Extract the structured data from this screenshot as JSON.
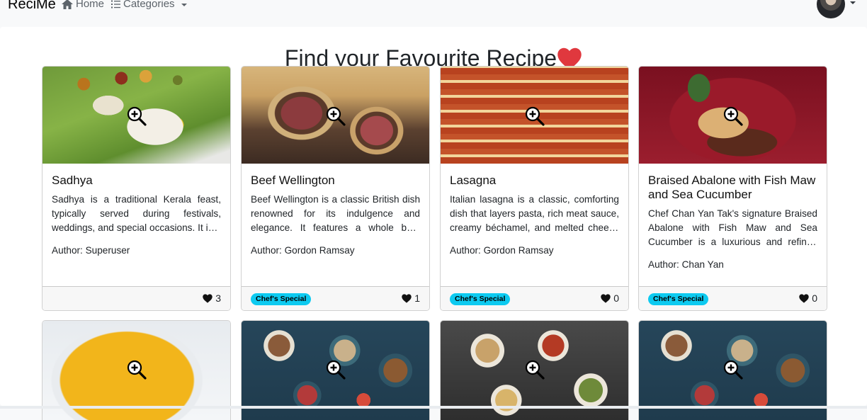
{
  "navbar": {
    "brand": "ReciMe",
    "home_label": "Home",
    "categories_label": "Categories"
  },
  "page": {
    "title": "Find your Favourite Recipe"
  },
  "recipes": [
    {
      "title": "Sadhya",
      "description": "Sadhya is a traditional Kerala feast, typically served during festivals, weddings, and special occasions. It is a vegetarian meal served on a banana leaf.",
      "author": "Author: Superuser",
      "badge": "",
      "likes": "3",
      "image": "sadhya-photo"
    },
    {
      "title": "Beef Wellington",
      "description": "Beef Wellington is a classic British dish renowned for its indulgence and elegance. It features a whole beef tenderloin wrapped in puff pastry.",
      "author": "Author: Gordon Ramsay",
      "badge": "Chef's Special",
      "likes": "1",
      "image": "beef-wellington-photo"
    },
    {
      "title": "Lasagna",
      "description": "Italian lasagna is a classic, comforting dish that layers pasta, rich meat sauce, creamy béchamel, and melted cheese baked to perfection.",
      "author": "Author: Gordon Ramsay",
      "badge": "Chef's Special",
      "likes": "0",
      "image": "lasagna-photo"
    },
    {
      "title": "Braised Abalone with Fish Maw and Sea Cucumber",
      "description": "Chef Chan Yan Tak's signature Braised Abalone with Fish Maw and Sea Cucumber is a luxurious and refined dish of Cantonese cuisine.",
      "author": "Author: Chan Yan",
      "badge": "Chef's Special",
      "likes": "0",
      "image": "braised-abalone-photo"
    }
  ],
  "recipes_row2": [
    {
      "image": "saffron-risotto-photo"
    },
    {
      "image": "mezze-spread-photo"
    },
    {
      "image": "asian-table-photo"
    },
    {
      "image": "mezze-spread-photo"
    }
  ],
  "colors": {
    "heart": "#e0383e",
    "badge": "#0dcaf0",
    "navbar_bg": "#f8f9fa"
  }
}
